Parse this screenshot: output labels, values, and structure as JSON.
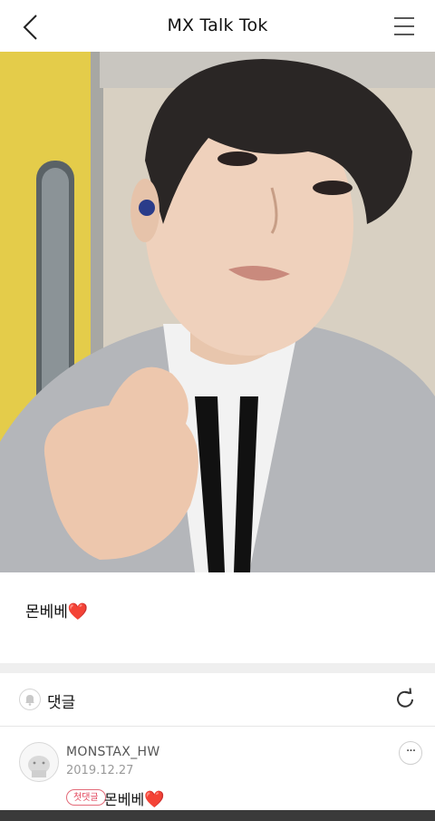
{
  "header": {
    "title": "MX Talk Tok",
    "back_icon": "chevron-left-icon",
    "menu_icon": "hamburger-menu-icon"
  },
  "post": {
    "photo_alt": "photo",
    "text": "몬베베",
    "heart": "❤️"
  },
  "comments": {
    "label": "댓글",
    "bell_icon": "bell-icon",
    "refresh_icon": "refresh-icon",
    "items": [
      {
        "username": "MONSTAX_HW",
        "date": "2019.12.27",
        "badge": "첫댓글",
        "text": "몬베베",
        "heart": "❤️",
        "more": "···"
      }
    ]
  },
  "colors": {
    "accent": "#e2262f",
    "badge": "#e2475c",
    "band": "#efefef"
  }
}
